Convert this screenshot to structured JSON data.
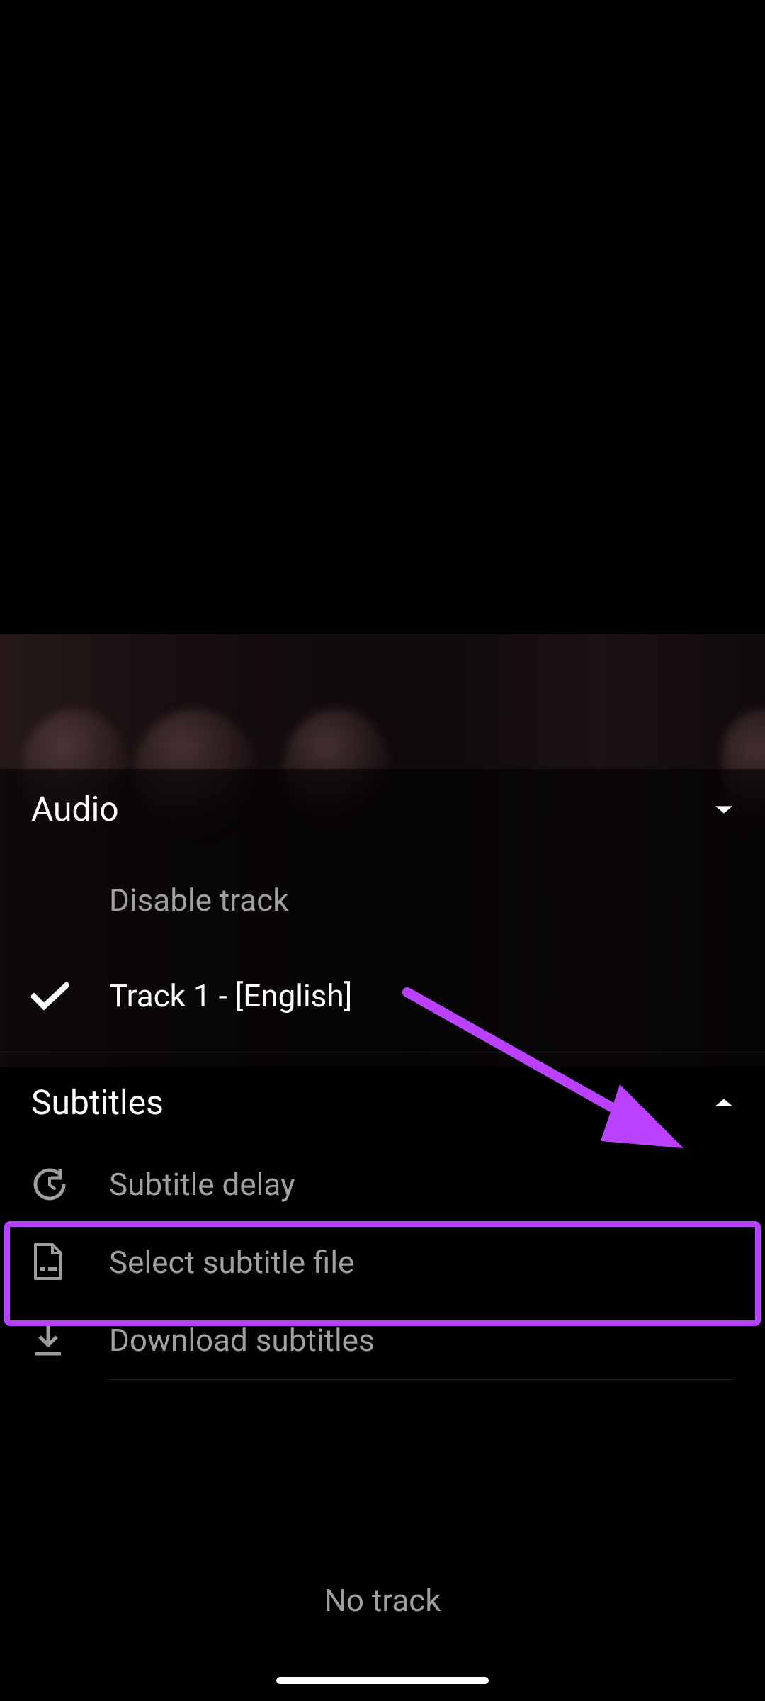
{
  "annotation": {
    "highlight_color": "#b941ff"
  },
  "sections": {
    "audio": {
      "title": "Audio",
      "expanded": false,
      "items": {
        "disable": "Disable track",
        "track1": "Track 1 - [English]",
        "selected": "track1"
      }
    },
    "subtitles": {
      "title": "Subtitles",
      "expanded": true,
      "items": {
        "delay": "Subtitle delay",
        "select_file": "Select subtitle file",
        "download": "Download subtitles"
      },
      "footer": "No track"
    }
  }
}
